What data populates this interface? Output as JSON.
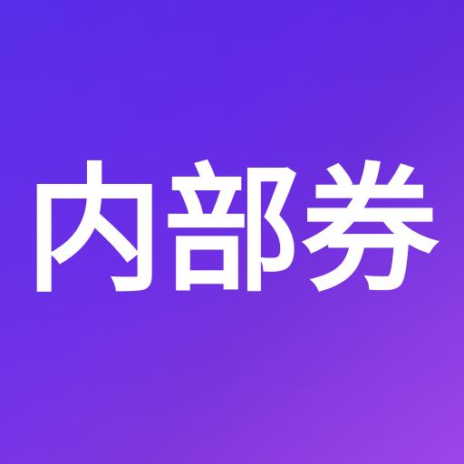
{
  "app_icon": {
    "logo_text": "内部券",
    "colors": {
      "gradient_start": "#4f22e8",
      "gradient_end": "#9a40ea",
      "text": "#ffffff"
    }
  }
}
